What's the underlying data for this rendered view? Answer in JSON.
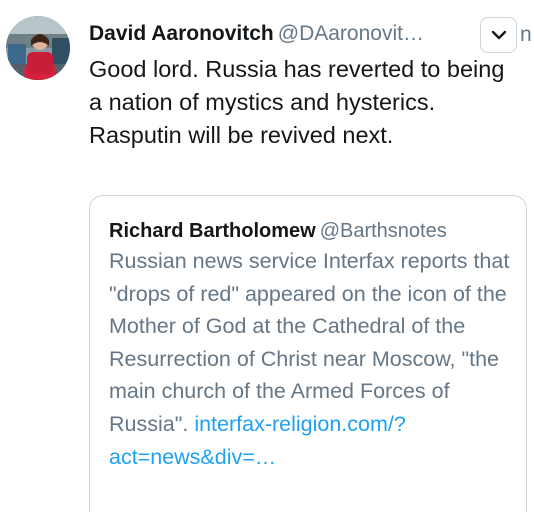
{
  "tweet": {
    "author": {
      "name": "David Aaronovitch",
      "handle": "@DAaronovit…"
    },
    "edge_glyph": "n",
    "text": "Good lord. Russia has reverted to being a nation of mystics and hysterics. Rasputin will be revived next."
  },
  "quoted_tweet": {
    "author": {
      "name": "Richard Bartholomew",
      "handle": "@Barthsnotes"
    },
    "text": "Russian news service Interfax reports that \"drops of red\" appeared on the icon of the Mother of God at the Cathedral of the Resurrection of Christ near Moscow, \"the main church of the Armed Forces of Russia\".",
    "link": "interfax-religion.com/?act=news&div=…"
  },
  "icons": {
    "caret": "chevron-down-icon",
    "avatar": "profile-photo"
  },
  "colors": {
    "text_primary": "#14171a",
    "text_secondary": "#657786",
    "link": "#1da1f2",
    "border": "#ccd6dd"
  }
}
